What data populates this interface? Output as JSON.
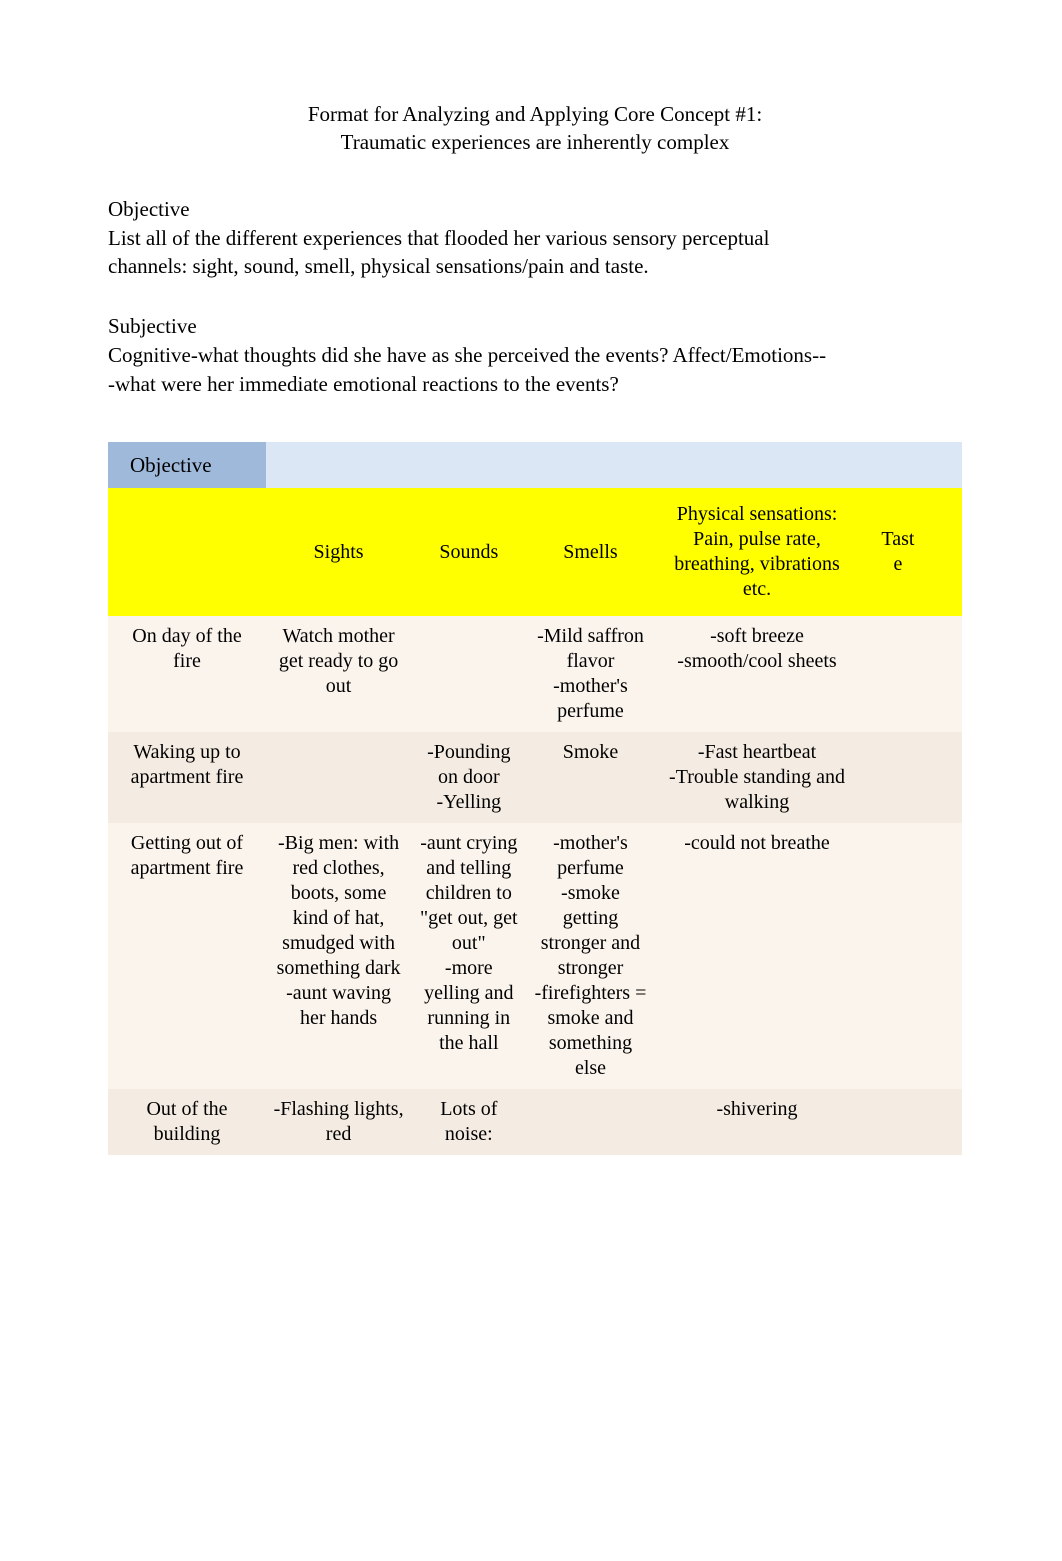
{
  "title": {
    "line1": "Format for Analyzing and Applying Core Concept #1:",
    "line2": "Traumatic experiences are inherently complex"
  },
  "objective_section": {
    "heading": "Objective",
    "body": "List all of the different experiences that flooded her various sensory perceptual channels: sight, sound, smell, physical sensations/pain and taste."
  },
  "subjective_section": {
    "heading": "Subjective",
    "body": "Cognitive-what thoughts did she have as she perceived the events? Affect/Emotions---what were her immediate emotional reactions to the events?"
  },
  "table": {
    "objective_label": "Objective",
    "headers": {
      "sights": "Sights",
      "sounds": "Sounds",
      "smells": "Smells",
      "physical": "Physical sensations: Pain, pulse rate, breathing, vibrations etc.",
      "taste": "Tast\ne"
    },
    "rows": [
      {
        "label": "On day of the fire",
        "sights": "Watch mother get ready to go out",
        "sounds": "",
        "smells": "-Mild saffron flavor\n-mother's perfume",
        "physical": "-soft breeze\n-smooth/cool sheets",
        "taste": ""
      },
      {
        "label": "Waking up to apartment fire",
        "sights": "",
        "sounds": "-Pounding on door\n-Yelling",
        "smells": "Smoke",
        "physical": "-Fast heartbeat\n-Trouble standing and walking",
        "taste": ""
      },
      {
        "label": "Getting out of apartment fire",
        "sights": "-Big men: with red clothes, boots, some kind of hat, smudged with something dark\n-aunt waving her hands",
        "sounds": "-aunt crying and telling children to \"get out, get out\"\n-more yelling and running in the hall",
        "smells": "-mother's perfume\n-smoke getting stronger and stronger\n-firefighters = smoke and something else",
        "physical": "-could not breathe",
        "taste": ""
      },
      {
        "label": "Out of the building",
        "sights": "-Flashing lights, red",
        "sounds": "Lots of noise:",
        "smells": "",
        "physical": "-shivering",
        "taste": ""
      }
    ]
  }
}
